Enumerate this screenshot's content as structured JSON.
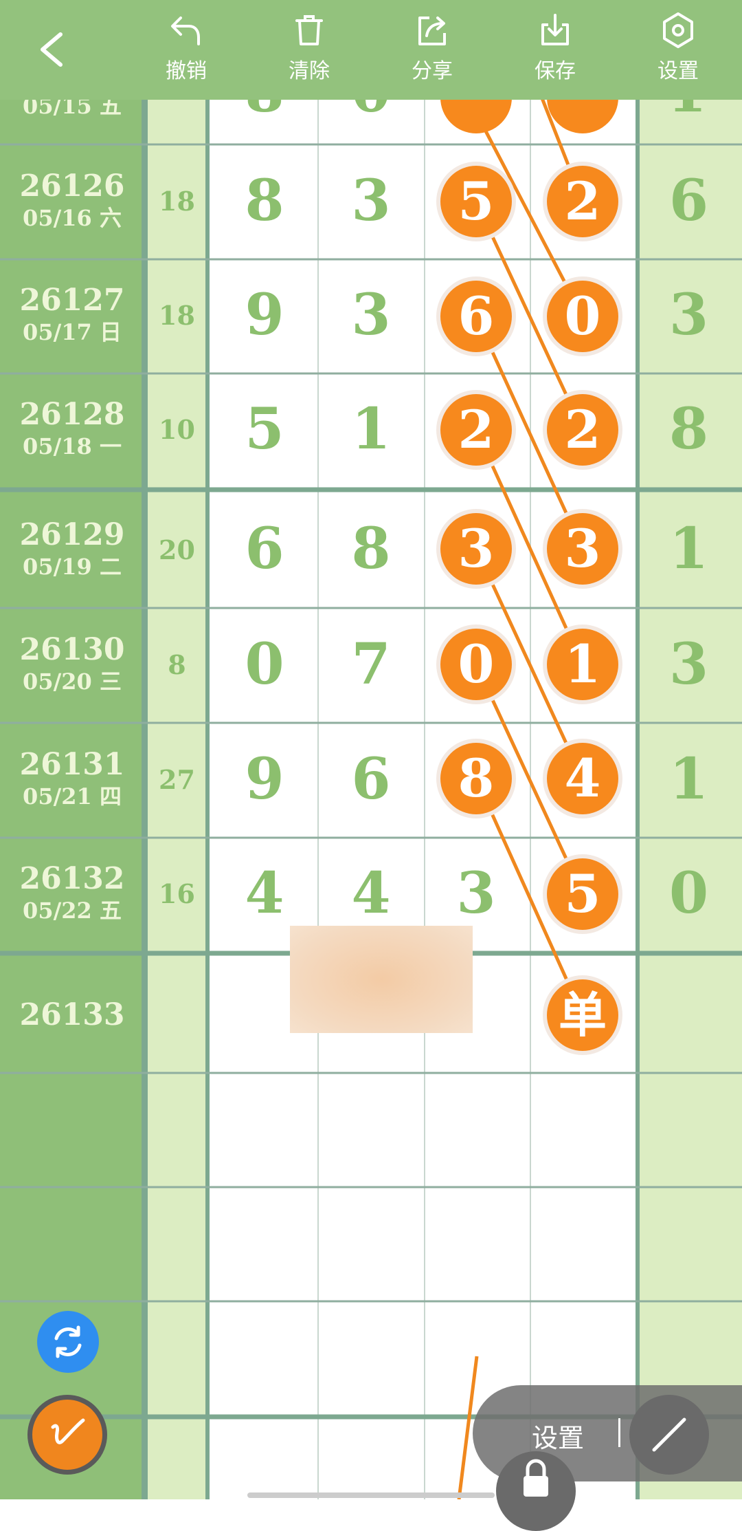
{
  "toolbar": {
    "undo_label": "撤销",
    "clear_label": "清除",
    "share_label": "分享",
    "save_label": "保存",
    "settings_label": "设置"
  },
  "colors": {
    "green_header": "#93c27d",
    "green_dark_col": "#8fbf78",
    "green_light_col": "#dcedc2",
    "digit_green": "#8cbf6e",
    "ball_orange": "#f7891d",
    "line_orange": "#f0881e",
    "fab_blue": "#2f8ef0"
  },
  "partial_row": {
    "date": "05/15 五"
  },
  "rows": [
    {
      "id": "26126",
      "date": "05/16 六",
      "sum": "18",
      "d1": "8",
      "d2": "3",
      "d3": "5",
      "d4": "2",
      "right": "6"
    },
    {
      "id": "26127",
      "date": "05/17 日",
      "sum": "18",
      "d1": "9",
      "d2": "3",
      "d3": "6",
      "d4": "0",
      "right": "3"
    },
    {
      "id": "26128",
      "date": "05/18 一",
      "sum": "10",
      "d1": "5",
      "d2": "1",
      "d3": "2",
      "d4": "2",
      "right": "8"
    },
    {
      "id": "26129",
      "date": "05/19 二",
      "sum": "20",
      "d1": "6",
      "d2": "8",
      "d3": "3",
      "d4": "3",
      "right": "1"
    },
    {
      "id": "26130",
      "date": "05/20 三",
      "sum": "8",
      "d1": "0",
      "d2": "7",
      "d3": "0",
      "d4": "1",
      "right": "3"
    },
    {
      "id": "26131",
      "date": "05/21 四",
      "sum": "27",
      "d1": "9",
      "d2": "6",
      "d3": "8",
      "d4": "4",
      "right": "1"
    },
    {
      "id": "26132",
      "date": "05/22 五",
      "sum": "16",
      "d1": "4",
      "d2": "4",
      "d3": "3",
      "d4": "5",
      "right": "0"
    }
  ],
  "next_row": {
    "id": "26133",
    "marker": "单"
  },
  "tool_panel": {
    "settings_label": "设置"
  },
  "icons": {
    "back": "chevron-left-icon",
    "undo": "undo-icon",
    "clear": "trash-icon",
    "share": "share-icon",
    "save": "download-icon",
    "settings": "gear-icon",
    "refresh": "refresh-icon",
    "pen": "pen-icon",
    "line_tool": "line-tool-icon",
    "lock": "lock-icon"
  }
}
